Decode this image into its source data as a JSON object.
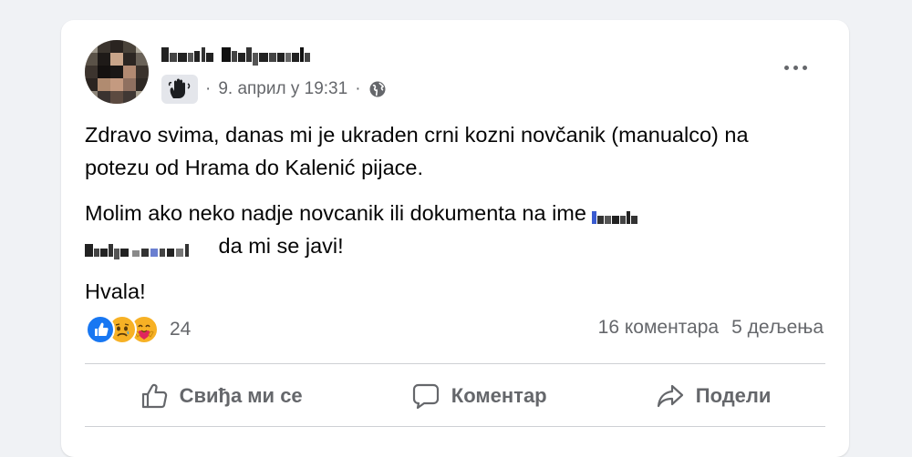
{
  "post": {
    "timestamp": "9. април у 19:31",
    "separator": "·",
    "body": {
      "p1": "Zdravo svima, danas mi je ukraden crni kozni novčanik (manualco) na potezu od Hrama do Kalenić pijace.",
      "p2_before": "Molim ako neko nadje novcanik ili dokumenta na ime",
      "p2_after": "da mi se javi!",
      "p3": "Hvala!"
    },
    "reactions": {
      "types": [
        "like-icon",
        "sad-icon",
        "care-icon"
      ],
      "count": "24"
    },
    "stats": {
      "comments": "16 коментара",
      "shares": "5 дељења"
    },
    "actions": {
      "like": "Свиђа ми се",
      "comment": "Коментар",
      "share": "Подели"
    }
  },
  "colors": {
    "background": "#f0f2f5",
    "card": "#ffffff",
    "secondary_text": "#65676b",
    "like_blue": "#1877f2",
    "reaction_yellow": "#f7b125"
  }
}
